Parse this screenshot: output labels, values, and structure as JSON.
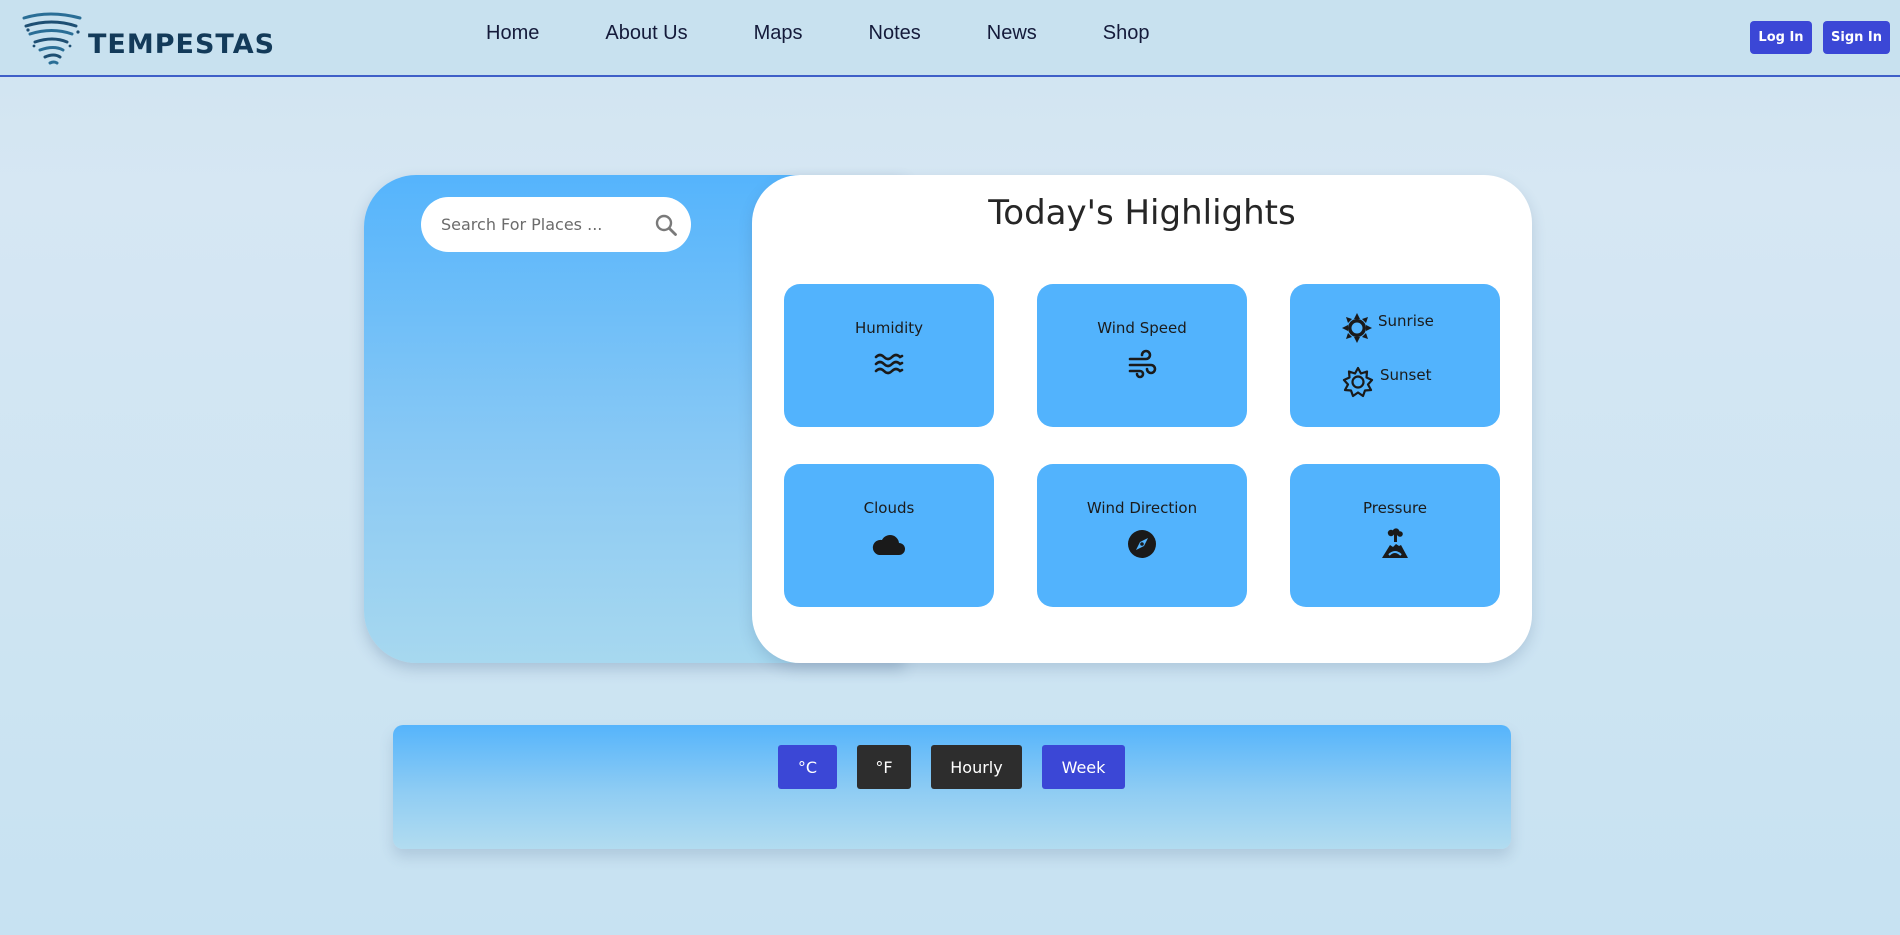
{
  "brand": {
    "name": "TEMPESTAS",
    "icon": "tornado-icon"
  },
  "nav": {
    "items": [
      {
        "label": "Home"
      },
      {
        "label": "About Us"
      },
      {
        "label": "Maps"
      },
      {
        "label": "Notes"
      },
      {
        "label": "News"
      },
      {
        "label": "Shop"
      }
    ]
  },
  "auth": {
    "login_label": "Log In",
    "signin_label": "Sign In"
  },
  "search": {
    "placeholder": "Search For Places ...",
    "value": "",
    "icon": "search-icon"
  },
  "highlights": {
    "title": "Today's Highlights",
    "tiles": [
      {
        "label": "Humidity",
        "icon": "water-waves-icon"
      },
      {
        "label": "Wind Speed",
        "icon": "wind-icon"
      },
      {
        "sunrise_label": "Sunrise",
        "sunset_label": "Sunset",
        "sunrise_icon": "sun-icon",
        "sunset_icon": "sun-outline-icon"
      },
      {
        "label": "Clouds",
        "icon": "cloud-icon"
      },
      {
        "label": "Wind Direction",
        "icon": "compass-icon"
      },
      {
        "label": "Pressure",
        "icon": "volcano-icon"
      }
    ]
  },
  "controls": {
    "celsius_label": "°C",
    "fahrenheit_label": "°F",
    "hourly_label": "Hourly",
    "week_label": "Week"
  },
  "colors": {
    "accent": "#3b47d6",
    "tile": "#52b3fd",
    "dark_button": "#2d2d2d",
    "header_bg": "#c8e1ef"
  }
}
